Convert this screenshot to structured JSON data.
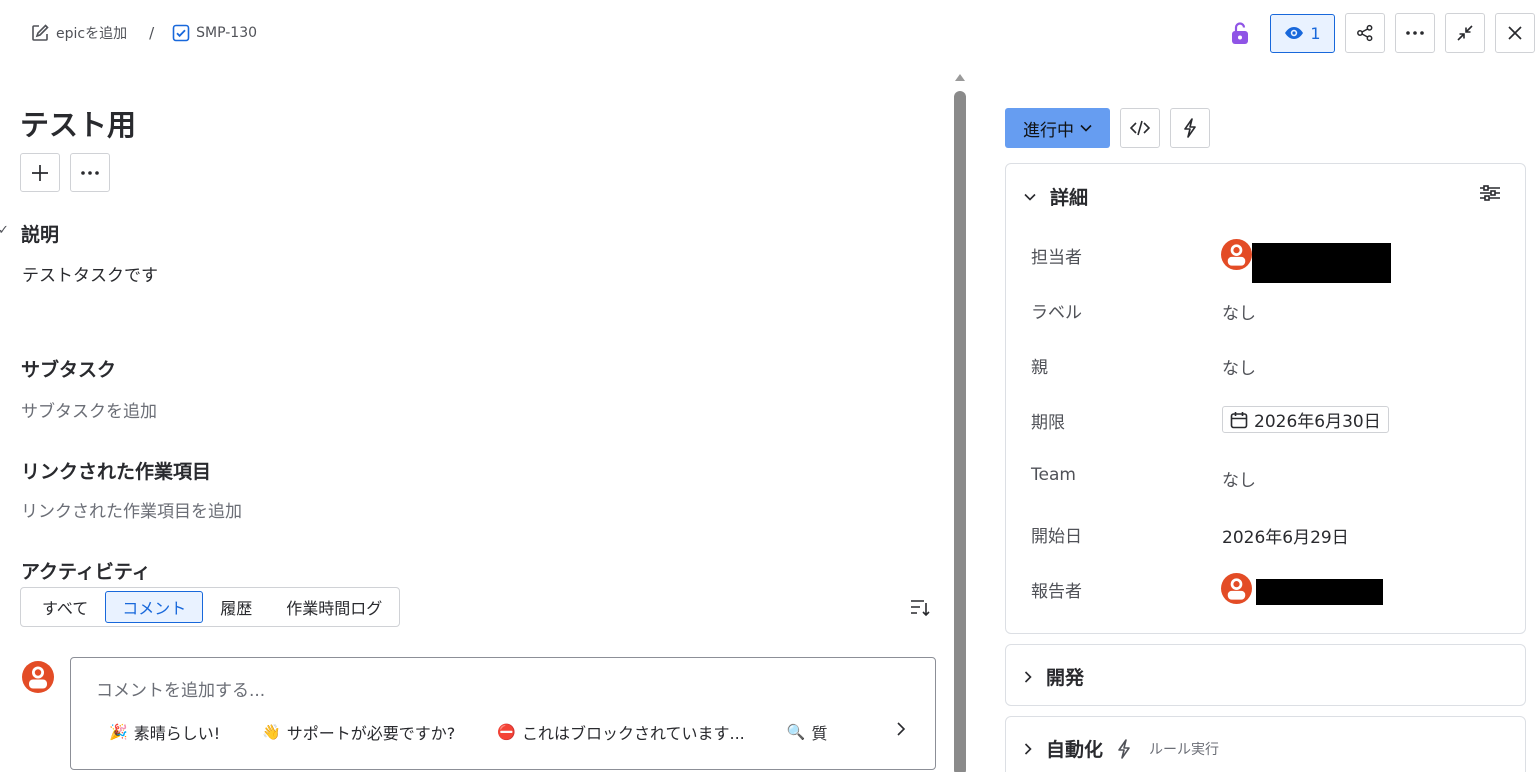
{
  "breadcrumb": {
    "epic_label": "epicを追加",
    "issue_key": "SMP-130"
  },
  "toolbar": {
    "watch_count": "1"
  },
  "issue": {
    "title": "テスト用"
  },
  "description": {
    "heading": "説明",
    "text": "テストタスクです"
  },
  "subtasks": {
    "heading": "サブタスク",
    "placeholder": "サブタスクを追加"
  },
  "linked": {
    "heading": "リンクされた作業項目",
    "placeholder": "リンクされた作業項目を追加"
  },
  "activity": {
    "heading": "アクティビティ",
    "tabs": [
      "すべて",
      "コメント",
      "履歴",
      "作業時間ログ"
    ],
    "active_tab": "コメント"
  },
  "comment": {
    "placeholder": "コメントを追加する...",
    "quick_replies": [
      {
        "emoji": "🎉",
        "label": "素晴らしい!"
      },
      {
        "emoji": "👋",
        "label": "サポートが必要ですか?"
      },
      {
        "emoji": "⛔",
        "label": "これはブロックされています..."
      },
      {
        "emoji": "🔍",
        "label": "質"
      }
    ]
  },
  "status": {
    "label": "進行中"
  },
  "details": {
    "heading": "詳細",
    "fields": {
      "assignee_label": "担当者",
      "label_label": "ラベル",
      "label_value": "なし",
      "parent_label": "親",
      "parent_value": "なし",
      "due_label": "期限",
      "due_value": "2026年6月30日",
      "team_label": "Team",
      "team_value": "なし",
      "start_label": "開始日",
      "start_value": "2026年6月29日",
      "reporter_label": "報告者"
    }
  },
  "development": {
    "heading": "開発"
  },
  "automation": {
    "heading": "自動化",
    "sub": "ルール実行"
  },
  "colors": {
    "accent": "#1868db",
    "status_bg": "#669df1",
    "avatar": "#e34c26",
    "lock": "#8f54e6"
  }
}
